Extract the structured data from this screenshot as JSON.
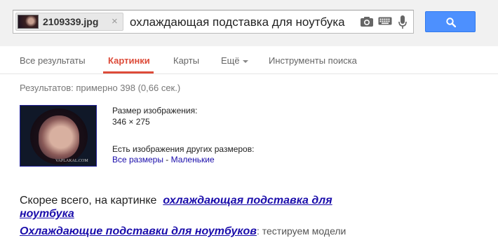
{
  "search": {
    "image_chip": {
      "filename": "2109339.jpg",
      "close_symbol": "×"
    },
    "query": "охлаждающая подставка для ноутбука",
    "icons": [
      "camera-icon",
      "keyboard-icon",
      "microphone-icon"
    ],
    "button_icon": "search-icon"
  },
  "nav": {
    "tabs": [
      {
        "label": "Все результаты"
      },
      {
        "label": "Картинки",
        "active": true
      },
      {
        "label": "Карты"
      },
      {
        "label": "Ещё"
      },
      {
        "label": "Инструменты поиска"
      }
    ]
  },
  "results": {
    "stats": "Результатов: примерно 398 (0,66 сек.)",
    "thumbnail": {
      "watermark": "VAPLAKAL.COM"
    },
    "size_label": "Размер изображения:",
    "size_value": "346 × 275",
    "other_sizes_label": "Есть изображения других размеров:",
    "all_sizes_link": "Все размеры",
    "separator": " - ",
    "small_link": "Маленькие",
    "best_guess_prefix": "Скорее всего, на картинке",
    "best_guess_link": "охлаждающая подставка для ноутбука",
    "next_title": "Охлаждающие подставки для ноутбуков",
    "next_snippet": ": тестируем модели"
  },
  "colors": {
    "accent_red": "#dd4b39",
    "link_blue": "#1a0dab",
    "button_blue": "#4d90fe",
    "topbar_bg": "#f1f1f1"
  }
}
